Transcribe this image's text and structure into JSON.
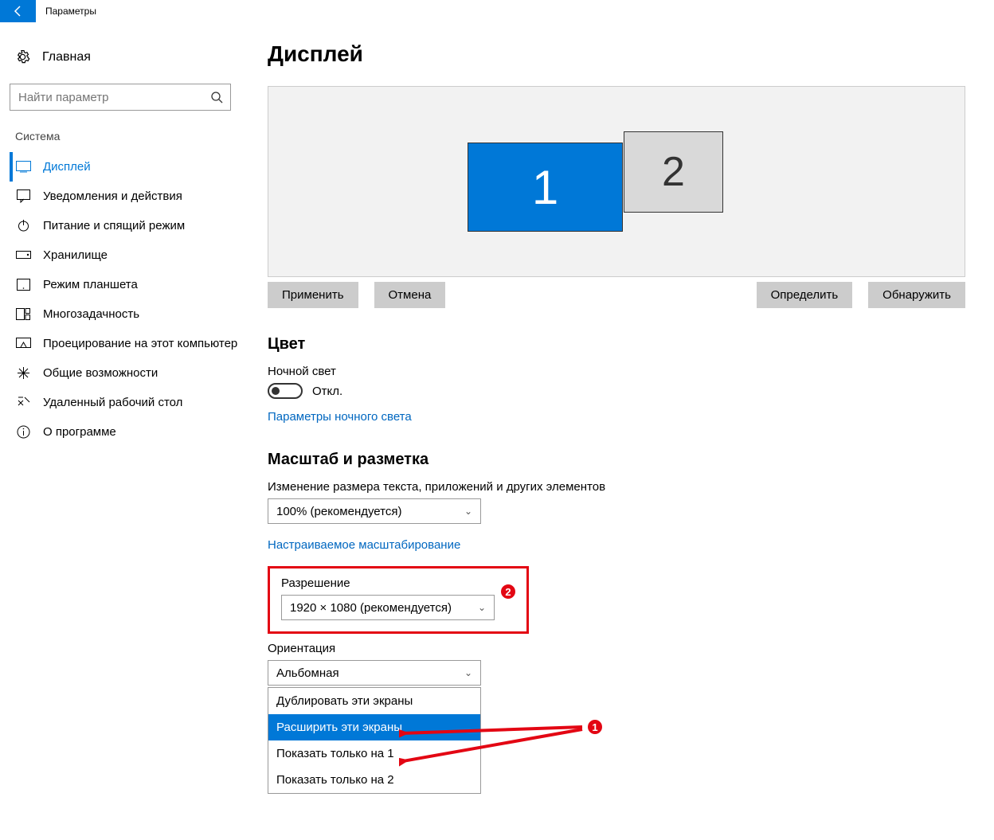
{
  "titlebar": {
    "app": "Параметры"
  },
  "sidebar": {
    "home": "Главная",
    "search_placeholder": "Найти параметр",
    "group": "Система",
    "items": [
      "Дисплей",
      "Уведомления и действия",
      "Питание и спящий режим",
      "Хранилище",
      "Режим планшета",
      "Многозадачность",
      "Проецирование на этот компьютер",
      "Общие возможности",
      "Удаленный рабочий стол",
      "О программе"
    ]
  },
  "main": {
    "title": "Дисплей",
    "display1": "1",
    "display2": "2",
    "apply": "Применить",
    "cancel": "Отмена",
    "identify": "Определить",
    "detect": "Обнаружить",
    "color_h": "Цвет",
    "night_light_label": "Ночной свет",
    "toggle_off": "Откл.",
    "night_light_link": "Параметры ночного света",
    "scale_h": "Масштаб и разметка",
    "scale_label": "Изменение размера текста, приложений и других элементов",
    "scale_value": "100% (рекомендуется)",
    "custom_scale_link": "Настраиваемое масштабирование",
    "resolution_label": "Разрешение",
    "resolution_value": "1920 × 1080 (рекомендуется)",
    "orientation_label": "Ориентация",
    "orientation_value": "Альбомная",
    "multi_options": [
      "Дублировать эти экраны",
      "Расширить эти экраны",
      "Показать только на 1",
      "Показать только на 2"
    ],
    "badge1": "1",
    "badge2": "2"
  }
}
